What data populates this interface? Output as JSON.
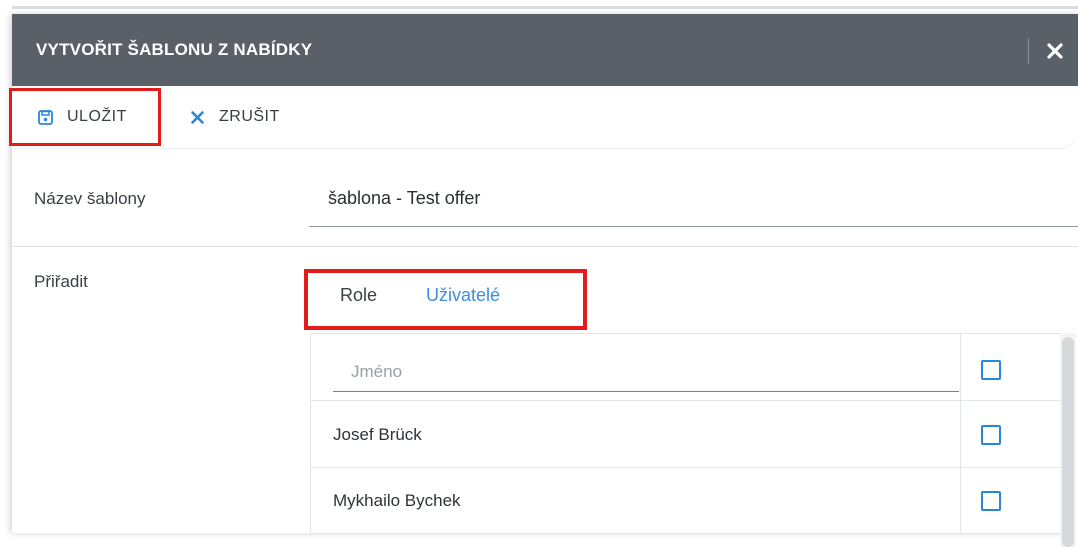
{
  "dialog": {
    "title": "VYTVOŘIT ŠABLONU Z NABÍDKY",
    "close_icon": "close-icon"
  },
  "toolbar": {
    "save_label": "ULOŽIT",
    "save_icon": "save-icon",
    "cancel_label": "ZRUŠIT",
    "cancel_icon": "close-icon"
  },
  "form": {
    "name_label": "Název šablony",
    "name_value": "šablona - Test offer",
    "assign_label": "Přiřadit"
  },
  "tabs": [
    {
      "label": "Role",
      "active": false
    },
    {
      "label": "Uživatelé",
      "active": true
    }
  ],
  "users_table": {
    "filter_placeholder": "Jméno",
    "rows": [
      {
        "name": "Josef Brück",
        "checked": false
      },
      {
        "name": "Mykhailo Bychek",
        "checked": false
      }
    ]
  },
  "colors": {
    "titlebar": "#596068",
    "accent": "#3b8ee0",
    "highlight": "#e21b1b"
  }
}
